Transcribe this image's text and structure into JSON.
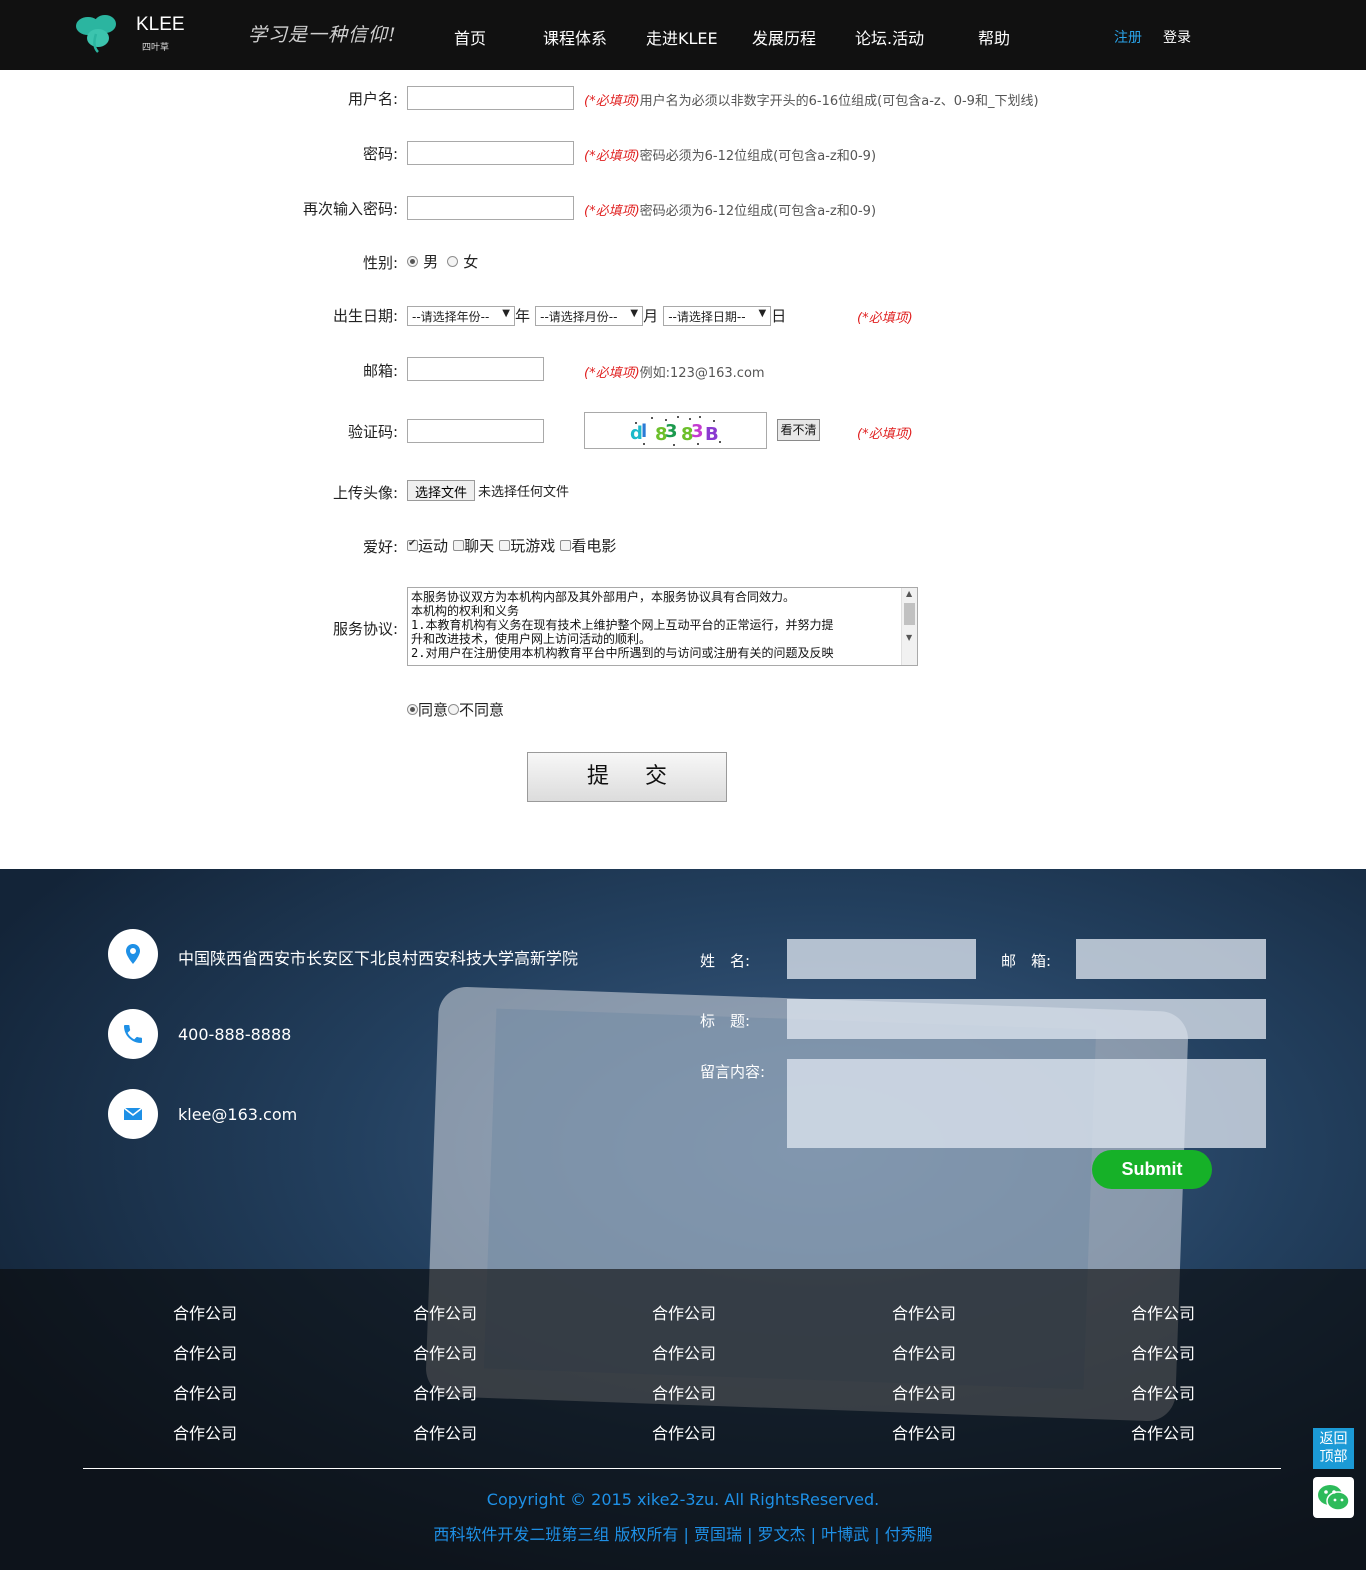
{
  "header": {
    "logo_title": "KLEE",
    "logo_subtitle": "四叶草",
    "slogan": "学习是一种信仰!",
    "nav": [
      "首页",
      "课程体系",
      "走进KLEE",
      "发展历程",
      "论坛.活动",
      "帮助"
    ],
    "register": "注册",
    "login": "登录"
  },
  "form": {
    "username": {
      "label": "用户名:",
      "value": "",
      "required": "(*必填项)",
      "hint": "用户名为必须以非数字开头的6-16位组成(可包含a-z、0-9和_下划线)"
    },
    "password": {
      "label": "密码:",
      "value": "",
      "required": "(*必填项)",
      "hint": "密码必须为6-12位组成(可包含a-z和0-9)"
    },
    "password2": {
      "label": "再次输入密码:",
      "value": "",
      "required": "(*必填项)",
      "hint": "密码必须为6-12位组成(可包含a-z和0-9)"
    },
    "gender": {
      "label": "性别:",
      "options": [
        "男",
        "女"
      ],
      "selected": "男"
    },
    "birthday": {
      "label": "出生日期:",
      "year_select": "--请选择年份--",
      "year_unit": "年",
      "month_select": "--请选择月份--",
      "month_unit": "月",
      "day_select": "--请选择日期--",
      "day_unit": "日",
      "required": "(*必填项)"
    },
    "email": {
      "label": "邮箱:",
      "value": "",
      "required": "(*必填项)",
      "hint": "例如:123@163.com"
    },
    "captcha": {
      "label": "验证码:",
      "value": "",
      "button": "看不清",
      "required": "(*必填项)"
    },
    "avatar": {
      "label": "上传头像:",
      "button": "选择文件",
      "status": "未选择任何文件"
    },
    "hobbies": {
      "label": "爱好:",
      "options": [
        "运动",
        "聊天",
        "玩游戏",
        "看电影"
      ],
      "checked": [
        "运动"
      ]
    },
    "agreement": {
      "label": "服务协议:",
      "lines": [
        "本服务协议双方为本机构内部及其外部用户，本服务协议具有合同效力。",
        "本机构的权利和义务",
        "1.本教育机构有义务在现有技术上维护整个网上互动平台的正常运行，并努力提",
        "升和改进技术，使用户网上访问活动的顺利。",
        "2.对用户在注册使用本机构教育平台中所遇到的与访问或注册有关的问题及反映"
      ]
    },
    "consent": {
      "options": [
        "同意",
        "不同意"
      ],
      "selected": "同意"
    },
    "submit": "提交"
  },
  "footer": {
    "address": "中国陕西省西安市长安区下北良村西安科技大学高新学院",
    "phone": "400-888-8888",
    "email": "klee@163.com",
    "message_form": {
      "name_label": "姓　名:",
      "email_label": "邮　箱:",
      "title_label": "标　题:",
      "content_label": "留言内容:",
      "submit": "Submit"
    },
    "partners": [
      [
        "合作公司",
        "合作公司",
        "合作公司",
        "合作公司",
        "合作公司"
      ],
      [
        "合作公司",
        "合作公司",
        "合作公司",
        "合作公司",
        "合作公司"
      ],
      [
        "合作公司",
        "合作公司",
        "合作公司",
        "合作公司",
        "合作公司"
      ],
      [
        "合作公司",
        "合作公司",
        "合作公司",
        "合作公司",
        "合作公司"
      ]
    ],
    "copyright": "Copyright © 2015 xike2-3zu. All RightsReserved.",
    "credits": "西科软件开发二班第三组 版权所有 | 贾国瑞 | 罗文杰 | 叶博武 | 付秀鹏"
  },
  "float": {
    "back_top": "返回顶部"
  },
  "colors": {
    "header_bg": "#111111",
    "accent_blue": "#1e90e6",
    "required_red": "#e02020",
    "green_submit": "#16b128"
  }
}
